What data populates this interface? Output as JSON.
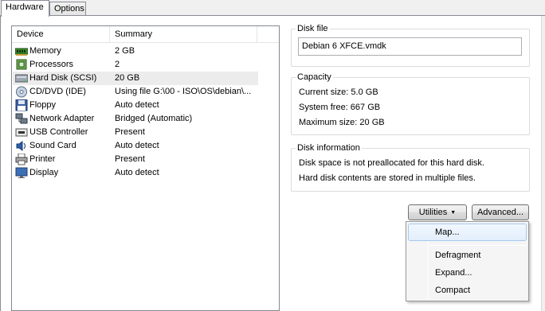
{
  "tabs": [
    {
      "label": "Hardware",
      "active": true
    },
    {
      "label": "Options",
      "active": false
    }
  ],
  "device_list": {
    "headers": {
      "device": "Device",
      "summary": "Summary"
    },
    "rows": [
      {
        "icon": "memory-icon",
        "device": "Memory",
        "summary": "2 GB",
        "selected": false
      },
      {
        "icon": "processor-icon",
        "device": "Processors",
        "summary": "2",
        "selected": false
      },
      {
        "icon": "hard-disk-icon",
        "device": "Hard Disk (SCSI)",
        "summary": "20 GB",
        "selected": true
      },
      {
        "icon": "cd-dvd-icon",
        "device": "CD/DVD (IDE)",
        "summary": "Using file G:\\00 - ISO\\OS\\debian\\...",
        "selected": false
      },
      {
        "icon": "floppy-icon",
        "device": "Floppy",
        "summary": "Auto detect",
        "selected": false
      },
      {
        "icon": "network-adapter-icon",
        "device": "Network Adapter",
        "summary": "Bridged (Automatic)",
        "selected": false
      },
      {
        "icon": "usb-controller-icon",
        "device": "USB Controller",
        "summary": "Present",
        "selected": false
      },
      {
        "icon": "sound-card-icon",
        "device": "Sound Card",
        "summary": "Auto detect",
        "selected": false
      },
      {
        "icon": "printer-icon",
        "device": "Printer",
        "summary": "Present",
        "selected": false
      },
      {
        "icon": "display-icon",
        "device": "Display",
        "summary": "Auto detect",
        "selected": false
      }
    ]
  },
  "disk_file": {
    "title": "Disk file",
    "value": "Debian 6 XFCE.vmdk"
  },
  "capacity": {
    "title": "Capacity",
    "current_size": "Current size:  5.0 GB",
    "system_free": "System free:  667 GB",
    "maximum_size": "Maximum size:  20 GB"
  },
  "disk_information": {
    "title": "Disk information",
    "line1": "Disk space is not preallocated for this hard disk.",
    "line2": "Hard disk contents are stored in multiple files."
  },
  "buttons": {
    "utilities": "Utilities",
    "advanced": "Advanced..."
  },
  "utilities_menu": {
    "items": [
      {
        "label": "Map...",
        "hover": true
      },
      {
        "label": "Defragment",
        "hover": false
      },
      {
        "label": "Expand...",
        "hover": false
      },
      {
        "label": "Compact",
        "hover": false
      }
    ]
  },
  "colors": {
    "selection": "#ececec",
    "menu_hover_border": "#a8c8ed"
  }
}
